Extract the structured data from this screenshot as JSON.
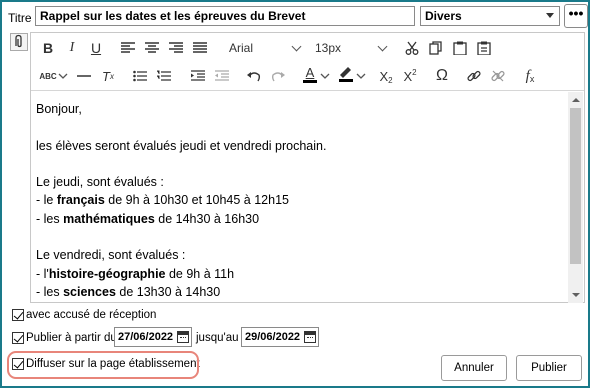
{
  "header": {
    "title_label": "Titre",
    "title_value": "Rappel sur les dates et les épreuves du Brevet",
    "category": "Divers",
    "more_label": "•••"
  },
  "toolbar": {
    "font": "Arial",
    "size": "13px",
    "text_color": "#000000",
    "highlight_color": "#000000"
  },
  "content": {
    "greeting": "Bonjour,",
    "intro": "les élèves seront évalués jeudi et vendredi prochain.",
    "thursday_title": "Le jeudi, sont évalués :",
    "thu1_pre": "- le ",
    "thu1_bold": "français",
    "thu1_post": " de 9h à 10h30 et 10h45 à 12h15",
    "thu2_pre": "- les ",
    "thu2_bold": "mathématiques",
    "thu2_post": " de 14h30 à 16h30",
    "friday_title": "Le vendredi, sont évalués :",
    "fri1_pre": "- l'",
    "fri1_bold": "histoire-géographie",
    "fri1_post": " de 9h à 11h",
    "fri2_pre": "- les ",
    "fri2_bold": "sciences",
    "fri2_post": " de 13h30 à 14h30"
  },
  "options": {
    "receipt_label": "avec accusé de réception",
    "publish_from_label": "Publier à partir du",
    "date_from": "27/06/2022",
    "until_label": "jusqu'au",
    "date_to": "29/06/2022",
    "diffuse_label": "Diffuser sur la page établissement"
  },
  "buttons": {
    "cancel": "Annuler",
    "publish": "Publier"
  }
}
